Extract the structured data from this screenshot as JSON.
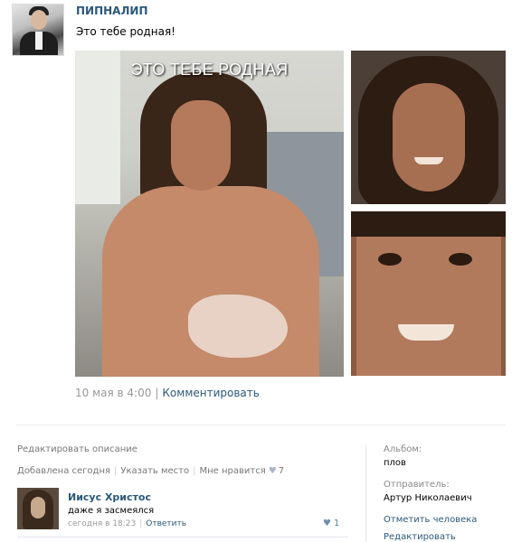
{
  "post": {
    "author": "ПИПНАЛИП",
    "text": "Это тебе родная!"
  },
  "photos": {
    "caption": "ЭТО ТЕБЕ РОДНАЯ"
  },
  "meta": {
    "date": "10 мая в 4:00",
    "comment_link": "Комментировать"
  },
  "photo_view": {
    "edit_description": "Редактировать описание",
    "added_today": "Добавлена сегодня",
    "set_place": "Указать место",
    "like_label": "Мне нравится",
    "like_count": "7"
  },
  "comment": {
    "author": "Иисус Христос",
    "text": "даже я засмеялся",
    "time": "сегодня в 18:23",
    "reply": "Ответить",
    "like_count": "1"
  },
  "sidebar": {
    "album_label": "Альбом:",
    "album_value": "плов",
    "sender_label": "Отправитель:",
    "sender_value": "Артур Николаевич",
    "mark_person": "Отметить человека",
    "edit": "Редактировать"
  },
  "colors": {
    "link": "#2b587a",
    "muted": "#999999",
    "heart": "#aab6c3"
  }
}
